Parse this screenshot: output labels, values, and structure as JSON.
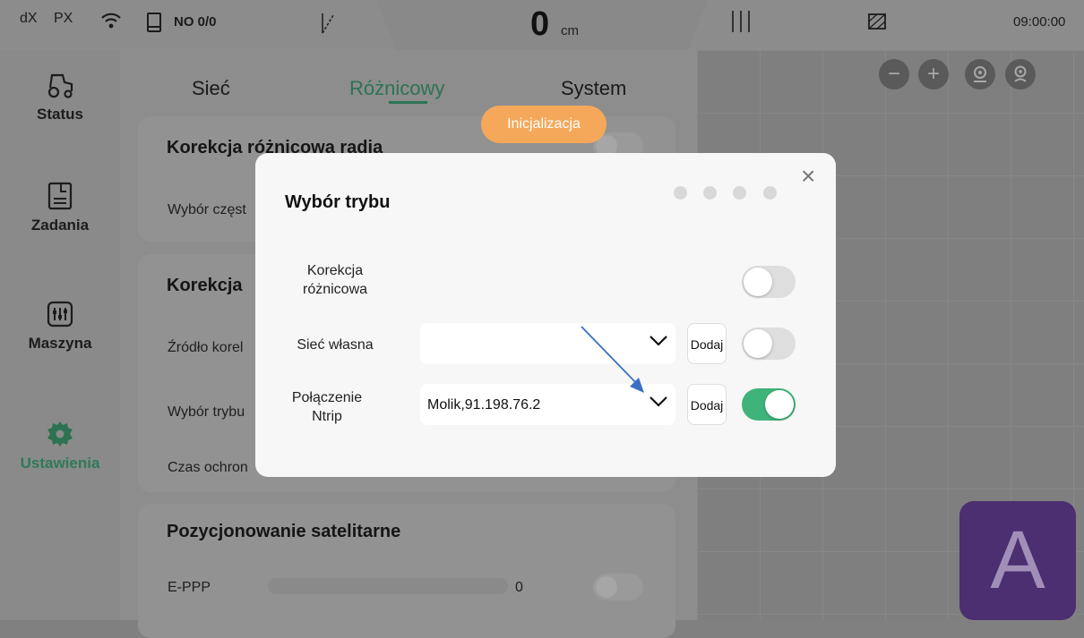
{
  "statusbar": {
    "diff_x_label": "dX",
    "pos_x_label": "PX",
    "no_label": "NO 0/0",
    "center_value": "0",
    "center_unit": "cm",
    "time": "09:00:00"
  },
  "sidebar": {
    "items": [
      {
        "label": "Status",
        "icon": "tractor-icon"
      },
      {
        "label": "Zadania",
        "icon": "task-icon"
      },
      {
        "label": "Maszyna",
        "icon": "machine-settings-icon"
      },
      {
        "label": "Ustawienia",
        "icon": "gear-icon",
        "active": true
      }
    ]
  },
  "tabs": [
    {
      "label": "Sieć"
    },
    {
      "label": "Różnicowy",
      "active": true
    },
    {
      "label": "System"
    }
  ],
  "panel": {
    "card1_title": "Korekcja różnicowa radia",
    "card1_row1": "Wybór częst",
    "card2_title": "Korekcja",
    "card2_row1": "Źródło korel",
    "card2_row2": "Wybór trybu",
    "card2_row3": "Czas ochron",
    "card3_title": "Pozycjonowanie satelitarne",
    "card3_row1": "E-PPP",
    "card3_row1_value": "0"
  },
  "init_badge": "Inicjalizacja",
  "modal": {
    "title": "Wybór trybu",
    "rows": [
      {
        "label": "Korekcja różnicowa",
        "toggle": false
      },
      {
        "label": "Sieć własna",
        "value": "",
        "button": "Dodaj",
        "toggle": false
      },
      {
        "label": "Połączenie Ntrip",
        "value": "Molik,91.198.76.2",
        "button": "Dodaj",
        "toggle": true
      }
    ]
  },
  "map": {
    "tile_letter": "A"
  },
  "colors": {
    "accent_green": "#2d7353",
    "toggle_on": "#3fb37a",
    "badge_orange": "#f5a85a",
    "tile_purple": "#4b2f70",
    "arrow_blue": "#3b6fc4"
  }
}
